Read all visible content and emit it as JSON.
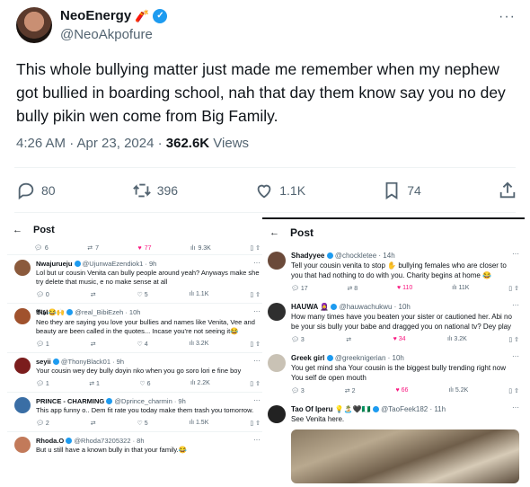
{
  "tweet": {
    "display_name": "NeoEnergy",
    "name_emoji": "🧨",
    "handle": "@NeoAkpofure",
    "text": "This whole bullying matter just made me remember when my nephew got bullied in boarding school, nah that day them know say you no dey bully pikin wen come from Big Family.",
    "time": "4:26 AM · Apr 23, 2024 · ",
    "views_count": "362.6K",
    "views_label": " Views",
    "more_glyph": "···",
    "actions": {
      "replies": "80",
      "reposts": "396",
      "likes": "1.1K",
      "bookmarks": "74"
    }
  },
  "left_panel": {
    "header": "Post",
    "top_stats": {
      "replies": "6",
      "reposts": "7",
      "likes": "77",
      "views": "9.3K"
    },
    "replies": [
      {
        "name": "Nwajurueju",
        "handle": "@UjunwaEzendiok1 · 9h",
        "text": "Lol but ur cousin Venita can bully people around yeah? Anyways make she try delete that music, e no make sense at all",
        "stats": [
          "0",
          "",
          "5",
          "1.1K"
        ],
        "color": "#8b5a3c"
      },
      {
        "name": "𝕭𝖎𝖇𝖎😂🙌",
        "handle": "@real_BibiEzeh · 10h",
        "text": "Neo they are saying you love your bullies and names like Venita, Vee and beauty are been called in the quotes... Incase you're not seeing it😂",
        "stats": [
          "1",
          "",
          "4",
          "3.2K"
        ],
        "color": "#a0522d"
      },
      {
        "name": "seyii",
        "handle": "@ThonyBlack01 · 9h",
        "text": "Your cousin wey dey bully doyin nko when you go soro lori e fine boy",
        "stats": [
          "1",
          "1",
          "6",
          "2.2K"
        ],
        "color": "#7b1d1d"
      },
      {
        "name": "PRINCE - CHARMING",
        "handle": "@Dprince_charmin · 9h",
        "text": "This app funny o.. Dem fit rate you today make them trash you tomorrow.",
        "stats": [
          "2",
          "",
          "5",
          "1.5K"
        ],
        "color": "#3a6ea5"
      },
      {
        "name": "Rhoda.O",
        "handle": "@Rhoda73205322 · 8h",
        "text": "But u still have a known bully in that your family.😂",
        "stats": [
          "",
          "",
          "",
          ""
        ],
        "color": "#c27a5a"
      }
    ]
  },
  "right_panel": {
    "header": "Post",
    "replies": [
      {
        "name": "Shadyyee",
        "handle": "@chockletee · 14h",
        "text": "Tell your cousin venita to stop ✋ bullying females who are closer to you that had nothing to do with you. Charity begins at home 😂",
        "stats": [
          "17",
          "8",
          "110",
          "11K"
        ],
        "color": "#6b4a3a"
      },
      {
        "name": "HAUWA 🧕",
        "handle": "@hauwachukwu · 10h",
        "text": "How many times have you beaten your sister or cautioned her. Abi no be your sis bully your babe and dragged you on national tv? Dey play",
        "stats": [
          "3",
          "",
          "34",
          "3.2K"
        ],
        "color": "#2f2f2f"
      },
      {
        "name": "Greek girl",
        "handle": "@greeknigerian · 10h",
        "text": "You get mind sha Your cousin is the biggest bully trending right now You self de open mouth",
        "stats": [
          "3",
          "2",
          "66",
          "5.2K"
        ],
        "color": "#c9c2b5"
      },
      {
        "name": "Tao Of Iperu 💡🏝️🖤🇳🇬",
        "handle": "@TaoFeek182 · 11h",
        "text": "See Venita here.",
        "stats": [
          "",
          "",
          "",
          ""
        ],
        "color": "#222222"
      }
    ]
  }
}
